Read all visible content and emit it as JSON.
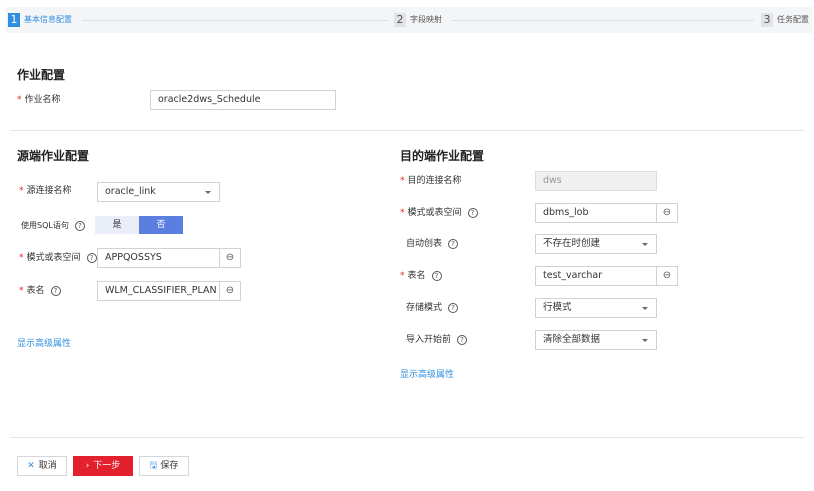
{
  "steps": [
    {
      "num": "1",
      "label": "基本信息配置",
      "active": true
    },
    {
      "num": "2",
      "label": "字段映射"
    },
    {
      "num": "3",
      "label": "任务配置"
    }
  ],
  "job": {
    "title": "作业配置",
    "name_label": "作业名称",
    "name_value": "oracle2dws_Schedule"
  },
  "source": {
    "title": "源端作业配置",
    "link_label": "源连接名称",
    "link_value": "oracle_link",
    "sql_label": "使用SQL语句",
    "sql_yes": "是",
    "sql_no": "否",
    "schema_label": "模式或表空间",
    "schema_value": "APPQOSSYS",
    "table_label": "表名",
    "table_value": "WLM_CLASSIFIER_PLAN",
    "advanced": "显示高级属性"
  },
  "dest": {
    "title": "目的端作业配置",
    "link_label": "目的连接名称",
    "link_value": "dws",
    "schema_label": "模式或表空间",
    "schema_value": "dbms_lob",
    "auto_label": "自动创表",
    "auto_value": "不存在时创建",
    "table_label": "表名",
    "table_value": "test_varchar",
    "storage_label": "存储模式",
    "storage_value": "行模式",
    "before_label": "导入开始前",
    "before_value": "清除全部数据",
    "advanced": "显示高级属性"
  },
  "footer": {
    "cancel": "取消",
    "next": "下一步",
    "save": "保存"
  },
  "colors": {
    "accent": "#2f8ee0",
    "primary_button": "#e3202d",
    "toggle_active": "#5b7fe0"
  }
}
